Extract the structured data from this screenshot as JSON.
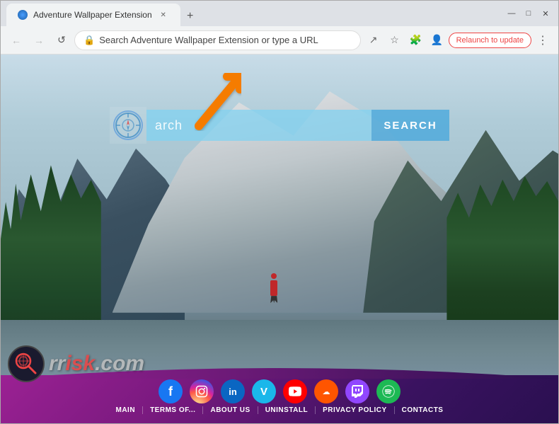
{
  "browser": {
    "tab_title": "Adventure Wallpaper Extension",
    "tab_favicon_alt": "browser-tab-icon",
    "address_bar_text": "Search Adventure Wallpaper Extension or type a URL",
    "relaunch_btn": "Relaunch to update"
  },
  "search": {
    "placeholder": "arch",
    "button_label": "SEARCH"
  },
  "social_icons": [
    {
      "name": "facebook",
      "symbol": "f",
      "class": "si-facebook"
    },
    {
      "name": "instagram",
      "symbol": "📷",
      "class": "si-instagram"
    },
    {
      "name": "linkedin",
      "symbol": "in",
      "class": "si-linkedin"
    },
    {
      "name": "vimeo",
      "symbol": "V",
      "class": "si-vimeo"
    },
    {
      "name": "youtube",
      "symbol": "▶",
      "class": "si-youtube"
    },
    {
      "name": "soundcloud",
      "symbol": "☁",
      "class": "si-soundcloud"
    },
    {
      "name": "twitch",
      "symbol": "🎮",
      "class": "si-twitch"
    },
    {
      "name": "spotify",
      "symbol": "♫",
      "class": "si-spotify"
    }
  ],
  "nav_links": [
    {
      "id": "main",
      "label": "MAIN"
    },
    {
      "id": "terms",
      "label": "TERMS OF..."
    },
    {
      "id": "about",
      "label": "ABOUT US"
    },
    {
      "id": "uninstall",
      "label": "UNINSTALL"
    },
    {
      "id": "privacy",
      "label": "PRIVACY POLICY"
    },
    {
      "id": "contacts",
      "label": "CONTACTS"
    }
  ],
  "logo": {
    "text": "risk.com"
  },
  "colors": {
    "accent_orange": "#f57c00",
    "search_bg": "rgba(130,210,240,0.75)",
    "search_btn": "rgba(80,170,220,0.85)",
    "bottom_bar_start": "#9b2193",
    "bottom_bar_end": "#2a1050"
  }
}
